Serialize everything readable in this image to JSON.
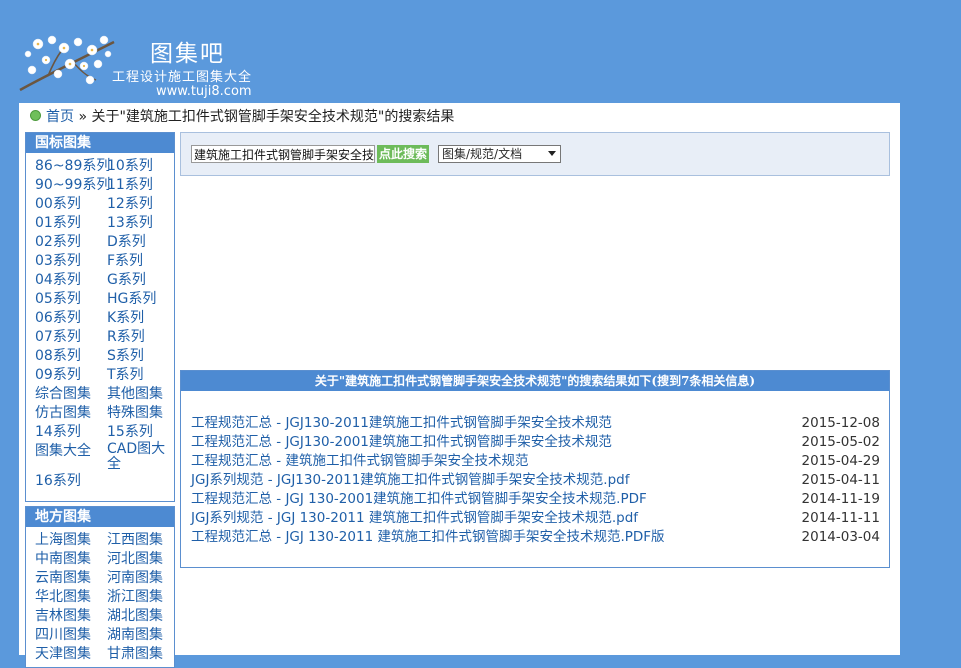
{
  "site": {
    "name": "图集吧",
    "subtitle": "工程设计施工图集大全",
    "url": "www.tuji8.com"
  },
  "breadcrumb": {
    "home": "首页",
    "separator": "»",
    "current": "关于\"建筑施工扣件式钢管脚手架安全技术规范\"的搜索结果"
  },
  "sidebar": {
    "guobiao": {
      "title": "国标图集",
      "items": [
        "86~89系列",
        "10系列",
        "90~99系列",
        "11系列",
        "00系列",
        "12系列",
        "01系列",
        "13系列",
        "02系列",
        "D系列",
        "03系列",
        "F系列",
        "04系列",
        "G系列",
        "05系列",
        "HG系列",
        "06系列",
        "K系列",
        "07系列",
        "R系列",
        "08系列",
        "S系列",
        "09系列",
        "T系列",
        "综合图集",
        "其他图集",
        "仿古图集",
        "特殊图集",
        "14系列",
        "15系列",
        "图集大全",
        "CAD图大全",
        "16系列"
      ]
    },
    "difang": {
      "title": "地方图集",
      "items": [
        "上海图集",
        "江西图集",
        "中南图集",
        "河北图集",
        "云南图集",
        "河南图集",
        "华北图集",
        "浙江图集",
        "吉林图集",
        "湖北图集",
        "四川图集",
        "湖南图集",
        "天津图集",
        "甘肃图集"
      ]
    }
  },
  "search": {
    "value": "建筑施工扣件式钢管脚手架安全技术规范",
    "button_label": "点此搜索",
    "category_selected": "图集/规范/文档"
  },
  "results": {
    "header": "关于\"建筑施工扣件式钢管脚手架安全技术规范\"的搜索结果如下(搜到7条相关信息)",
    "items": [
      {
        "title": "工程规范汇总 - JGJ130-2011建筑施工扣件式钢管脚手架安全技术规范",
        "date": "2015-12-08"
      },
      {
        "title": "工程规范汇总 - JGJ130-2001建筑施工扣件式钢管脚手架安全技术规范",
        "date": "2015-05-02"
      },
      {
        "title": "工程规范汇总 - 建筑施工扣件式钢管脚手架安全技术规范",
        "date": "2015-04-29"
      },
      {
        "title": "JGJ系列规范 - JGJ130-2011建筑施工扣件式钢管脚手架安全技术规范.pdf",
        "date": "2015-04-11"
      },
      {
        "title": "工程规范汇总 - JGJ 130-2001建筑施工扣件式钢管脚手架安全技术规范.PDF",
        "date": "2014-11-19"
      },
      {
        "title": "JGJ系列规范 - JGJ 130-2011 建筑施工扣件式钢管脚手架安全技术规范.pdf",
        "date": "2014-11-11"
      },
      {
        "title": "工程规范汇总 - JGJ 130-2011 建筑施工扣件式钢管脚手架安全技术规范.PDF版",
        "date": "2014-03-04"
      }
    ]
  },
  "colors": {
    "background": "#5b99dc",
    "header_bar": "#4d8ad2",
    "link": "#1f5fa8",
    "search_button": "#6dbb5a"
  }
}
